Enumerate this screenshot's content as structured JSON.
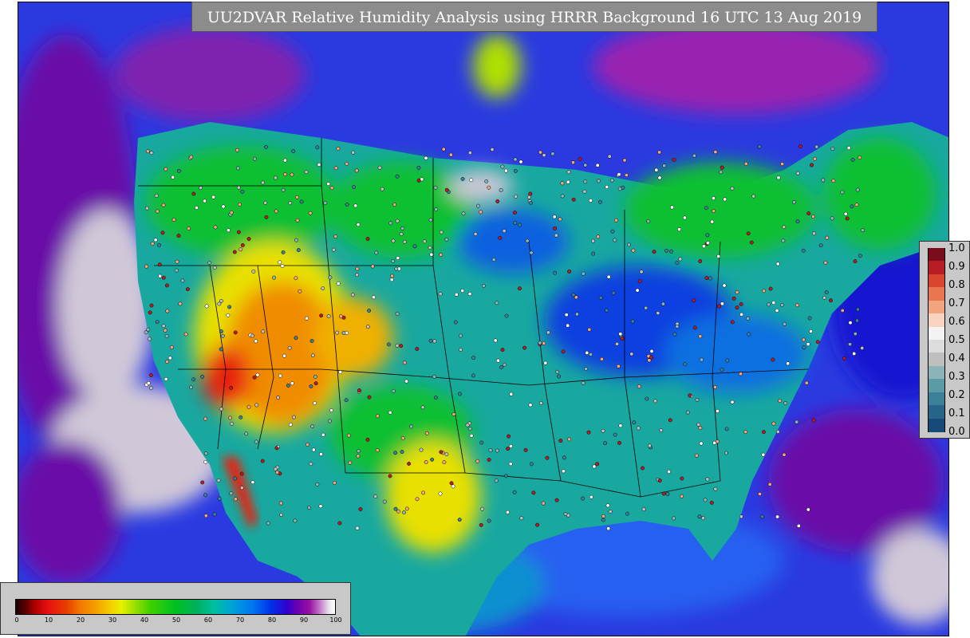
{
  "title": "UU2DVAR Relative Humidity Analysis using HRRR Background 16 UTC 13 Aug 2019",
  "colorbar_rh": {
    "tick_labels": [
      "0",
      "10",
      "20",
      "30",
      "40",
      "50",
      "60",
      "70",
      "80",
      "90",
      "100"
    ]
  },
  "colorbar_ratio": {
    "tick_labels": [
      "1.0",
      "0.9",
      "0.8",
      "0.7",
      "0.6",
      "0.5",
      "0.4",
      "0.3",
      "0.2",
      "0.1",
      "0.0"
    ],
    "colors": [
      "#7a0c1c",
      "#b71c24",
      "#d8442e",
      "#e8764f",
      "#f2a47e",
      "#f8d3c0",
      "#f3f3f3",
      "#dcdcdc",
      "#bfbfbf",
      "#8cb4b8",
      "#5a9ba6",
      "#3c7f98",
      "#27648a",
      "#174a76"
    ]
  },
  "map_colors": {
    "ocean_moist": "#2a2ae0",
    "ocean_deep": "#6a10a8",
    "saturated": "#d0c8d8",
    "land_green": "#10c030",
    "land_teal": "#18a8a0",
    "land_blue": "#1070e0",
    "dry_yellow": "#e8e000",
    "dry_orange": "#f08c00",
    "very_dry": "#e82010"
  }
}
